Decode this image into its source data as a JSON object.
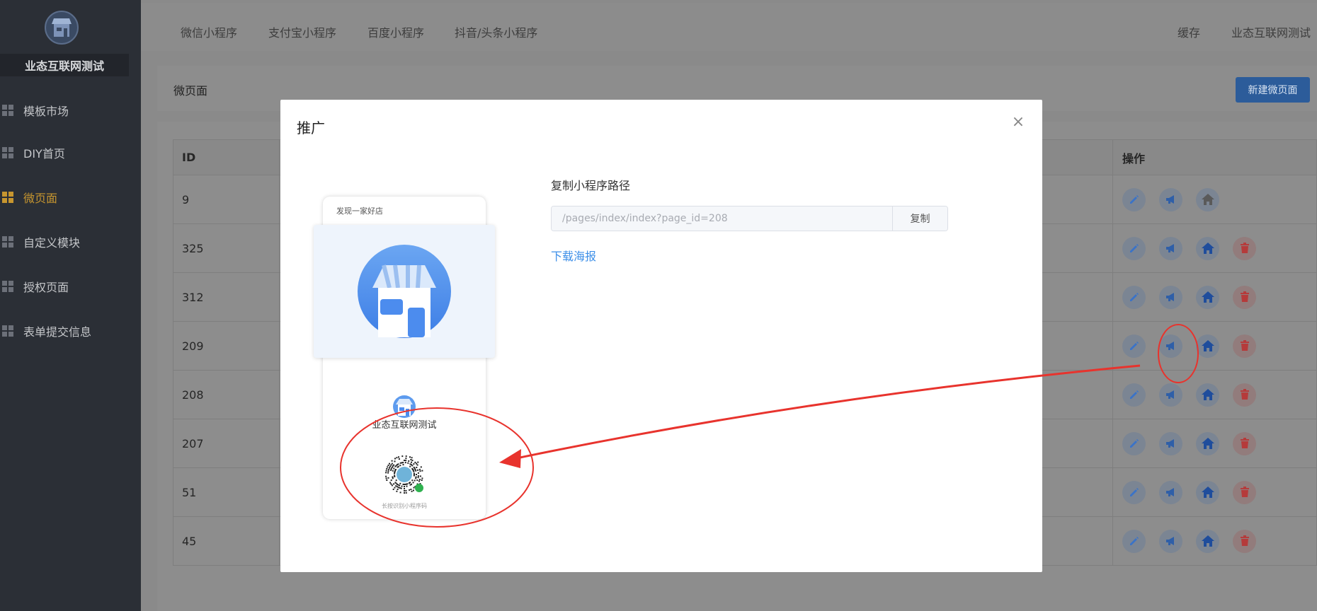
{
  "sidebar": {
    "site_name": "业态互联网测试",
    "items": [
      {
        "label": "模板市场"
      },
      {
        "label": "DIY首页"
      },
      {
        "label": "微页面"
      },
      {
        "label": "自定义模块"
      },
      {
        "label": "授权页面"
      },
      {
        "label": "表单提交信息"
      }
    ],
    "active_index": 2
  },
  "topbar": {
    "tabs": [
      {
        "label": "微信小程序"
      },
      {
        "label": "支付宝小程序"
      },
      {
        "label": "百度小程序"
      },
      {
        "label": "抖音/头条小程序"
      }
    ],
    "cache_label": "缓存",
    "user_label": "业态互联网测试"
  },
  "page": {
    "title": "微页面",
    "new_button": "新建微页面"
  },
  "table": {
    "headers": {
      "id": "ID",
      "actions": "操作"
    },
    "rows": [
      {
        "id": "9"
      },
      {
        "id": "325"
      },
      {
        "id": "312"
      },
      {
        "id": "209"
      },
      {
        "id": "208"
      },
      {
        "id": "207"
      },
      {
        "id": "51"
      },
      {
        "id": "45"
      }
    ]
  },
  "modal": {
    "title": "推广",
    "close": "×",
    "poster": {
      "header": "发现一家好店",
      "shop_name": "业态互联网测试",
      "qr_label": "长按识别小程序码"
    },
    "path_label": "复制小程序路径",
    "path_value": "/pages/index/index?page_id=208",
    "copy_button": "复制",
    "download_link": "下载海报"
  },
  "colors": {
    "accent": "#3d8fe8",
    "sidebar_active": "#c7962f",
    "annotation": "#e8332d"
  }
}
